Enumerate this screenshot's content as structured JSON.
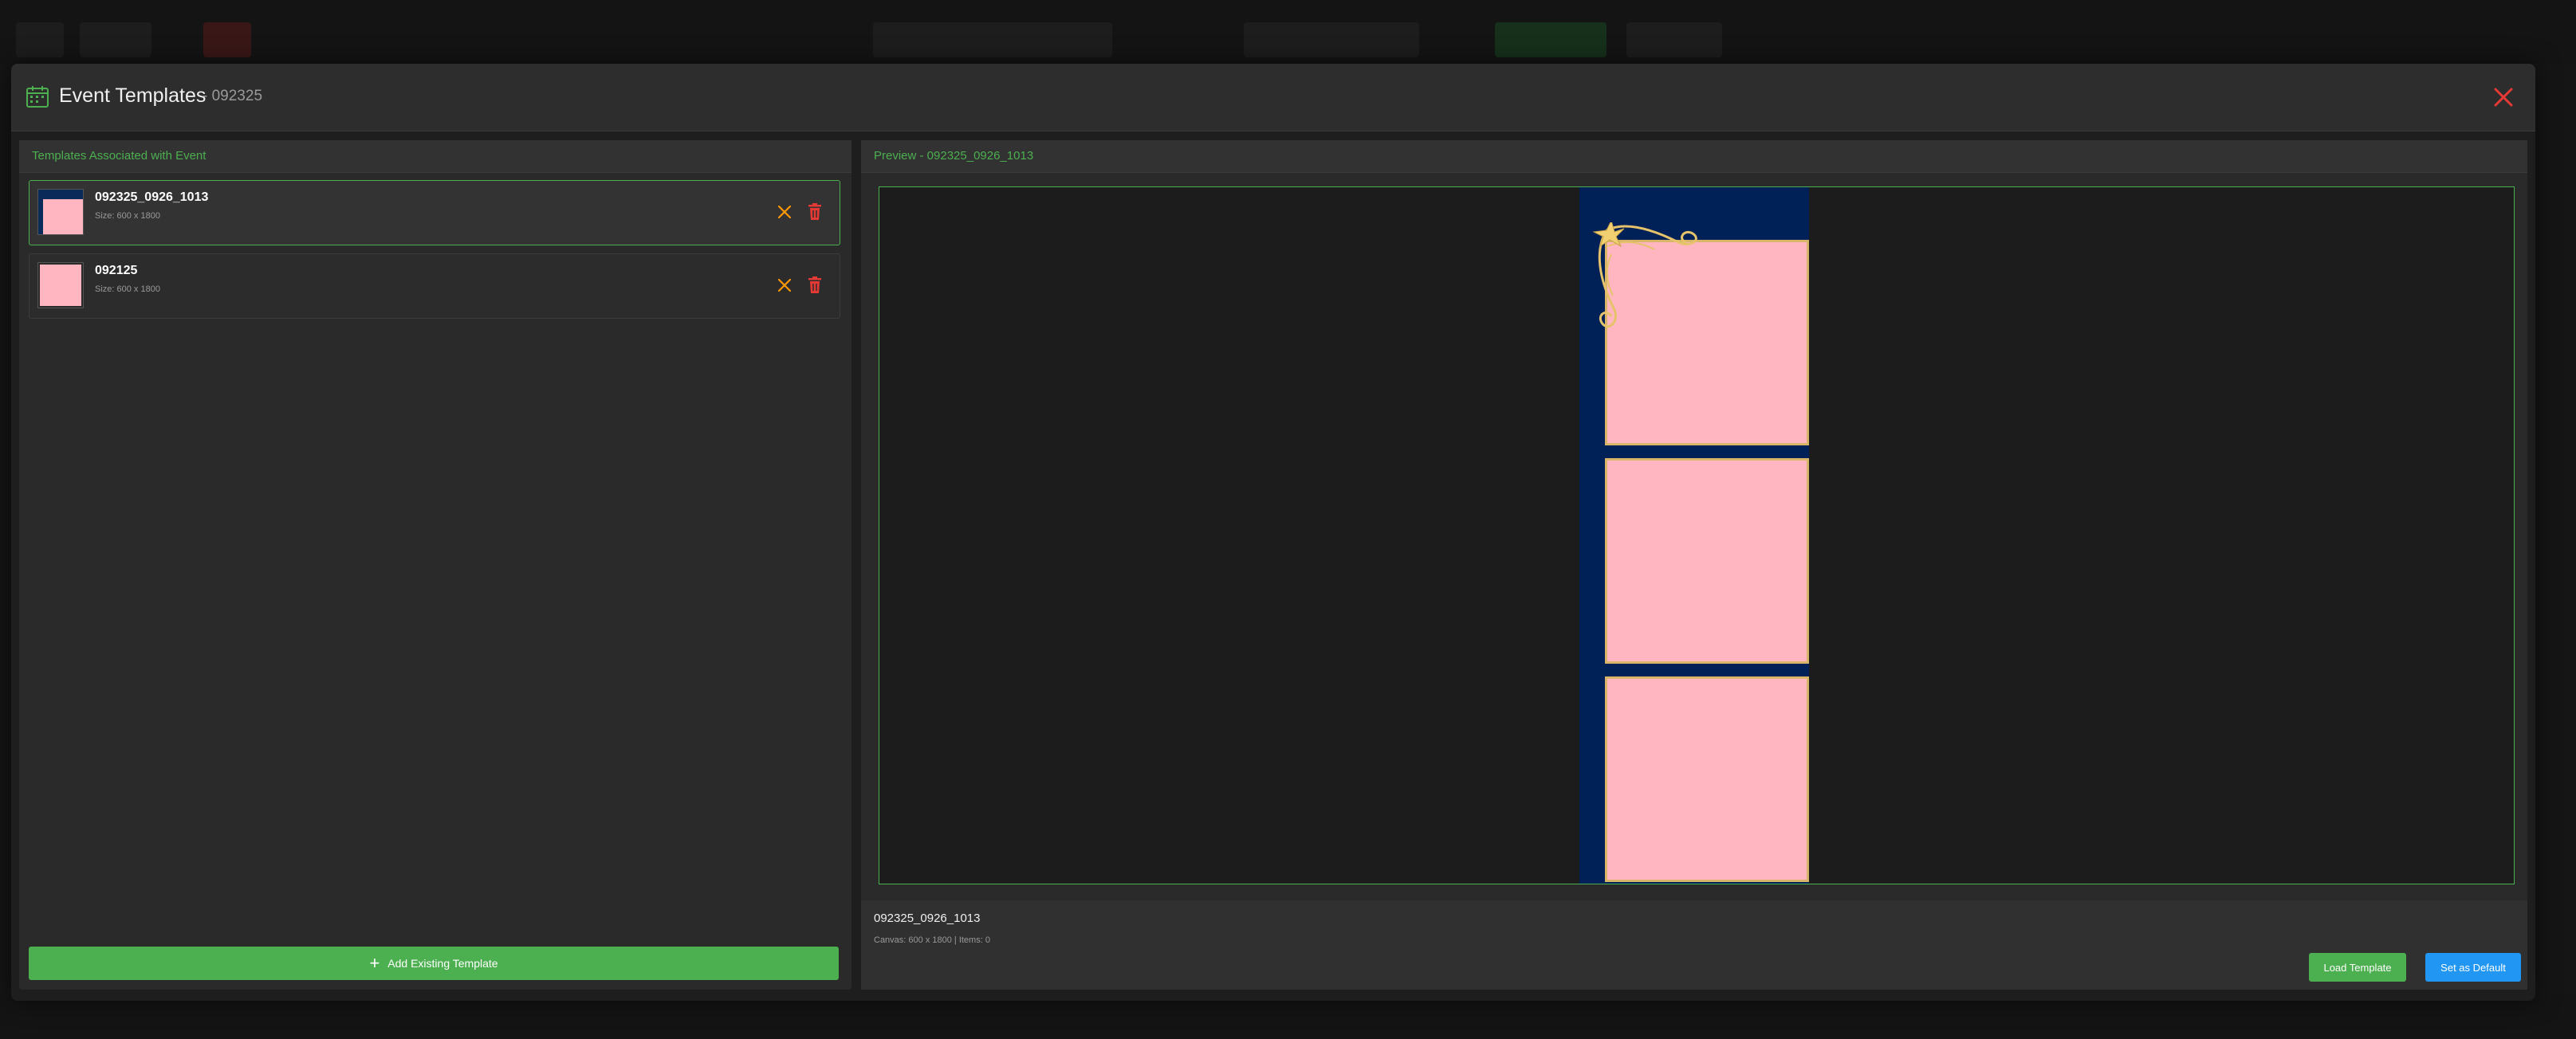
{
  "modal": {
    "title": "Event Templates",
    "subtitle": "- 092325",
    "close_icon": "close-icon",
    "accent_color": "#4caf50",
    "danger_color": "#e53935"
  },
  "left_panel": {
    "header": "Templates Associated with Event",
    "templates": [
      {
        "name": "092325_0926_1013",
        "size": "Size: 600 x 1800",
        "selected": true
      },
      {
        "name": "092125",
        "size": "Size: 600 x 1800",
        "selected": false
      }
    ],
    "add_button": {
      "icon": "plus-icon",
      "label": "Add Existing Template"
    }
  },
  "preview": {
    "header": "Preview - 092325_0926_1013",
    "template_name": "092325_0926_1013",
    "canvas_meta": "Canvas: 600 x 1800 | Items: 0",
    "strip_color": "#002157",
    "photo_slot_color": "#ffb6c1",
    "slot_border_color": "#d9b56a",
    "load_button": "Load Template",
    "default_button": "Set as Default",
    "default_button_color": "#2196f3"
  }
}
